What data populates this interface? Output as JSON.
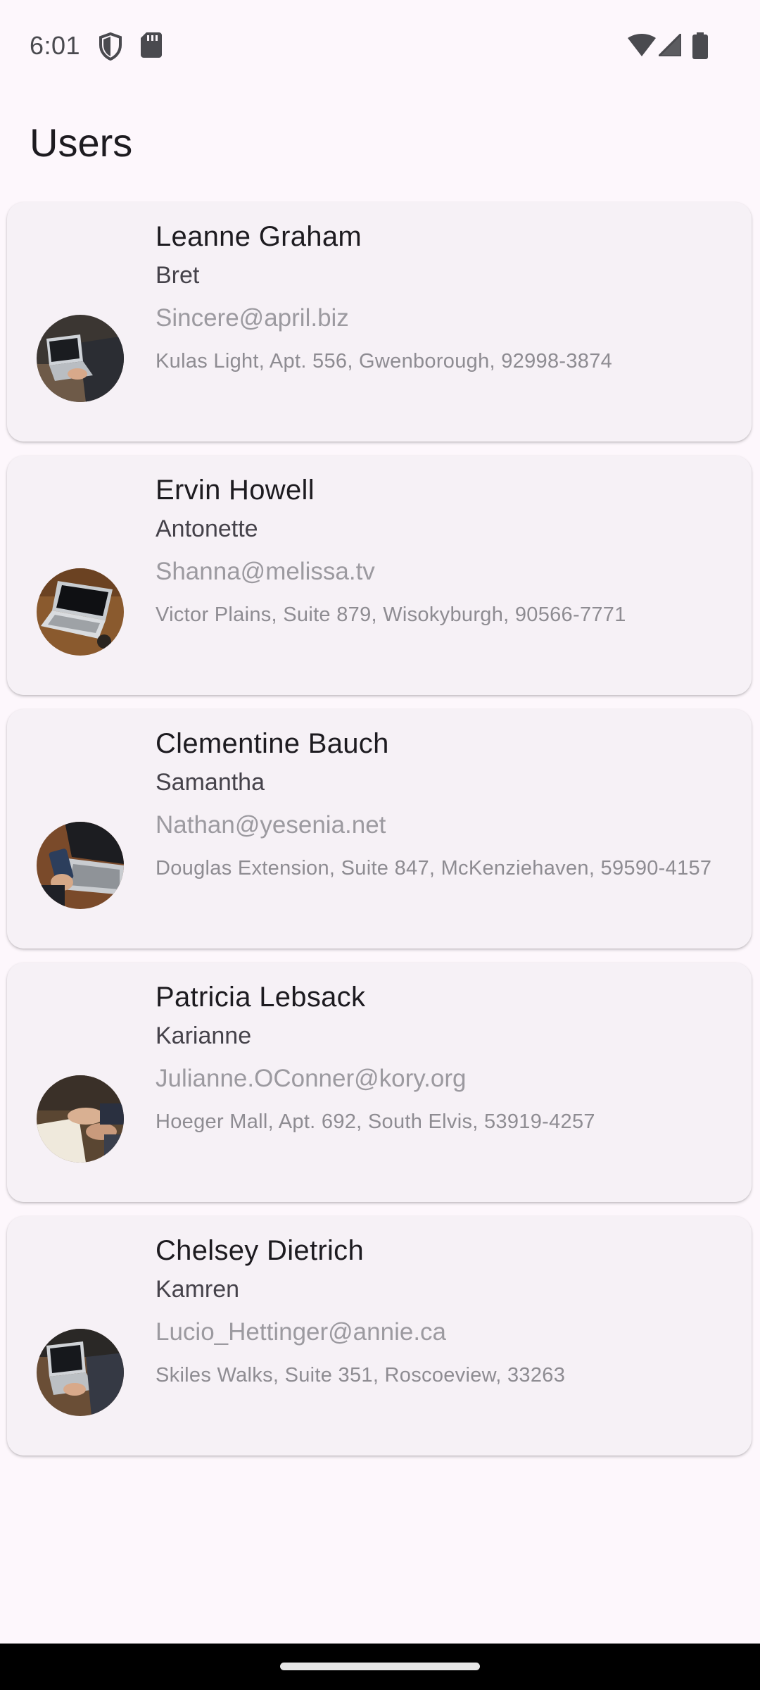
{
  "status_bar": {
    "time": "6:01",
    "left_icons": [
      "shield-icon",
      "sd-card-icon"
    ],
    "right_icons": [
      "wifi-icon",
      "cell-signal-icon",
      "battery-icon"
    ]
  },
  "page": {
    "title": "Users"
  },
  "users": [
    {
      "name": "Leanne Graham",
      "username": "Bret",
      "email": "Sincere@april.biz",
      "address": "Kulas Light, Apt. 556, Gwenborough, 92998-3874",
      "avatar": "laptop-photo-avatar"
    },
    {
      "name": "Ervin Howell",
      "username": "Antonette",
      "email": "Shanna@melissa.tv",
      "address": "Victor Plains, Suite 879, Wisokyburgh, 90566-7771",
      "avatar": "laptop-desk-photo-avatar"
    },
    {
      "name": "Clementine Bauch",
      "username": "Samantha",
      "email": "Nathan@yesenia.net",
      "address": "Douglas Extension, Suite 847, McKenziehaven, 59590-4157",
      "avatar": "phone-laptop-photo-avatar"
    },
    {
      "name": "Patricia Lebsack",
      "username": "Karianne",
      "email": "Julianne.OConner@kory.org",
      "address": "Hoeger Mall, Apt. 692, South Elvis, 53919-4257",
      "avatar": "hands-notebook-photo-avatar"
    },
    {
      "name": "Chelsey Dietrich",
      "username": "Kamren",
      "email": "Lucio_Hettinger@annie.ca",
      "address": "Skiles Walks, Suite 351, Roscoeview, 33263",
      "avatar": "laptop-typing-photo-avatar"
    }
  ],
  "colors": {
    "background": "#fdf7fc",
    "card": "#f6f1f6",
    "name_text": "#1d1b20",
    "username_text": "#45424a",
    "email_text": "#9c9aa0",
    "address_text": "#8e8c92"
  }
}
